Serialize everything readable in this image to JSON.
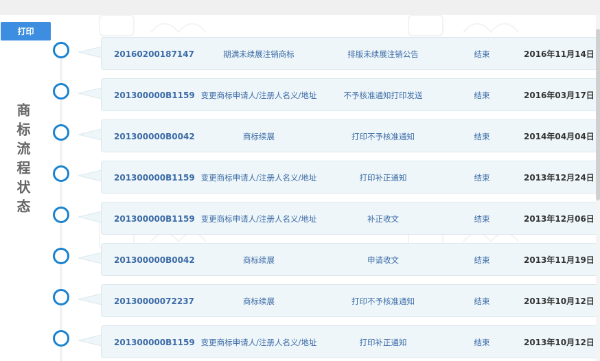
{
  "toolbar": {
    "print_label": "打印"
  },
  "side_title": "商标流程状态",
  "records": [
    {
      "no": "20160200187147",
      "type": "期满未续展注销商标",
      "step": "排版未续展注销公告",
      "result": "结束",
      "date": "2016年11月14日"
    },
    {
      "no": "201300000B1159",
      "type": "变更商标申请人/注册人名义/地址",
      "step": "不予核准通知打印发送",
      "result": "结束",
      "date": "2016年03月17日"
    },
    {
      "no": "201300000B0042",
      "type": "商标续展",
      "step": "打印不予核准通知",
      "result": "结束",
      "date": "2014年04月04日"
    },
    {
      "no": "201300000B1159",
      "type": "变更商标申请人/注册人名义/地址",
      "step": "打印补正通知",
      "result": "结束",
      "date": "2013年12月24日"
    },
    {
      "no": "201300000B1159",
      "type": "变更商标申请人/注册人名义/地址",
      "step": "补正收文",
      "result": "结束",
      "date": "2013年12月06日"
    },
    {
      "no": "201300000B0042",
      "type": "商标续展",
      "step": "申请收文",
      "result": "结束",
      "date": "2013年11月19日"
    },
    {
      "no": "20130000072237",
      "type": "商标续展",
      "step": "打印不予核准通知",
      "result": "结束",
      "date": "2013年10月12日"
    },
    {
      "no": "201300000B1159",
      "type": "变更商标申请人/注册人名义/地址",
      "step": "打印补正通知",
      "result": "结束",
      "date": "2013年10月12日"
    }
  ],
  "colors": {
    "accent": "#3d8ee0",
    "dot": "#1a82cf",
    "card_bg": "#eef6f9",
    "text_blue": "#3b6aa6",
    "date": "#333333"
  }
}
